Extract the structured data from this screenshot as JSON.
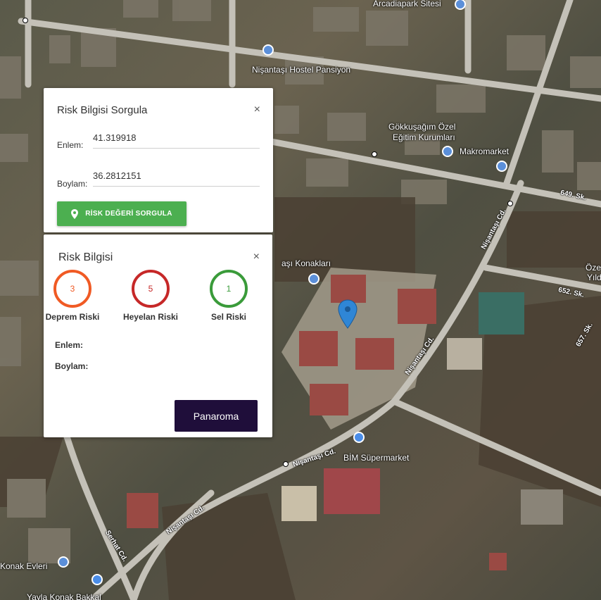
{
  "map": {
    "places": {
      "arcadiapark": "Arcadiapark Sitesi",
      "hostel": "Nişantaşı Hostel Pansiyon",
      "gokkusagi_1": "Gökkuşağım Özel",
      "gokkusagi_2": "Eğitim Kurumları",
      "makromarket": "Makromarket",
      "konaklari": "aşı Konakları",
      "bim": "BİM Süpermarket",
      "konak_evleri": "Konak Evleri",
      "yayla": "Yayla Konak Bakkal",
      "ozel_1": "Öze",
      "ozel_2": "Yıld"
    },
    "roads": {
      "r649": "649. Sk.",
      "r652": "652. Sk.",
      "r657": "657. Sk.",
      "nisantasi_1": "Nişantaşı Cd.",
      "nisantasi_2": "Nişantaşı Cd.",
      "nisantasi_3": "Nişantaşı Cd.",
      "nisantasi_4": "Nişantaşı Cd.",
      "serhat": "Serhat Cd."
    }
  },
  "query_panel": {
    "title": "Risk Bilgisi Sorgula",
    "close": "×",
    "lat_label": "Enlem:",
    "lat_value": "41.319918",
    "lon_label": "Boylam:",
    "lon_value": "36.2812151",
    "button_label": "RİSK DEĞERİ SORGULA",
    "button_color": "#4caf50"
  },
  "risk_panel": {
    "title": "Risk Bilgisi",
    "close": "×",
    "gauges": [
      {
        "value": "3",
        "label": "Deprem Riski",
        "color": "#f05a24"
      },
      {
        "value": "5",
        "label": "Heyelan Riski",
        "color": "#c62828"
      },
      {
        "value": "1",
        "label": "Sel Riski",
        "color": "#3a9b3a"
      }
    ],
    "lat_label": "Enlem:",
    "lon_label": "Boylam:",
    "panorama_label": "Panaroma",
    "panorama_color": "#1f0e3a"
  },
  "marker_color": "#2f86d6"
}
